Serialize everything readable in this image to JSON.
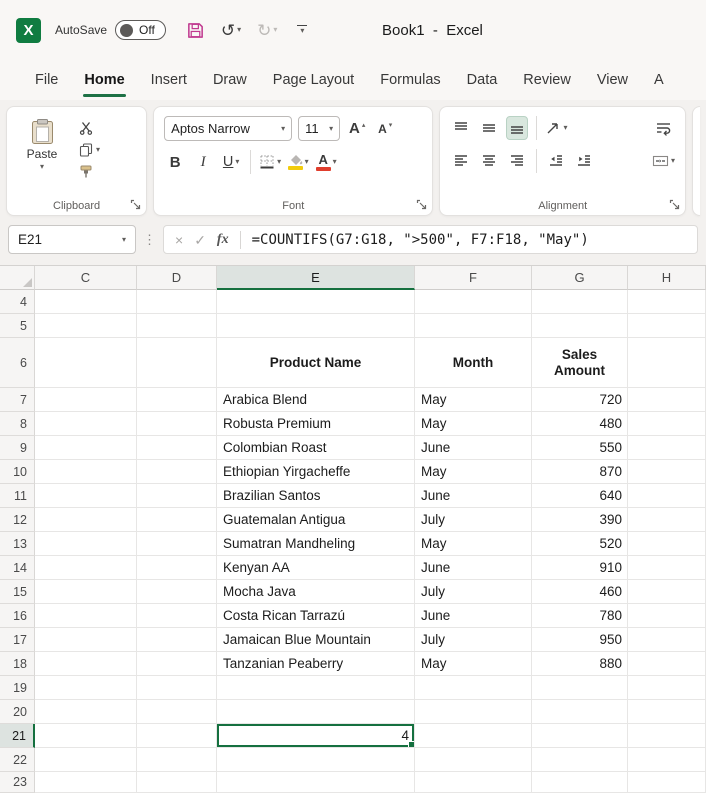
{
  "colors": {
    "excel_green": "#107c41",
    "tab_underline_green": "#1e7145",
    "selection_green": "#15703f",
    "save_icon_magenta": "#c0398f",
    "fill_color_yellow": "#f2cc0c",
    "font_color_red": "#e03e2d"
  },
  "titlebar": {
    "logo_letter": "X",
    "autosave_label": "AutoSave",
    "autosave_state": "Off",
    "title": "Book1  -  Excel",
    "icons": [
      "excel-logo-icon",
      "save-icon",
      "undo-icon",
      "redo-icon",
      "customize-toolbar-chevron-icon"
    ]
  },
  "menu": {
    "tabs": [
      {
        "label": "File",
        "active": false
      },
      {
        "label": "Home",
        "active": true
      },
      {
        "label": "Insert",
        "active": false
      },
      {
        "label": "Draw",
        "active": false
      },
      {
        "label": "Page Layout",
        "active": false
      },
      {
        "label": "Formulas",
        "active": false
      },
      {
        "label": "Data",
        "active": false
      },
      {
        "label": "Review",
        "active": false
      },
      {
        "label": "View",
        "active": false
      },
      {
        "label": "A",
        "active": false
      }
    ]
  },
  "ribbon": {
    "clipboard": {
      "label": "Clipboard",
      "paste_label": "Paste",
      "icons": [
        "clipboard-paste-icon",
        "scissors-cut-icon",
        "copy-icon",
        "format-painter-icon",
        "dialog-launcher-icon"
      ]
    },
    "font": {
      "label": "Font",
      "font_name": "Aptos Narrow",
      "font_size": "11",
      "grow_font_label": "A",
      "shrink_font_label": "A",
      "bold_label": "B",
      "italic_label": "I",
      "underline_label": "U",
      "font_color_label": "A",
      "icons": [
        "borders-icon",
        "fill-color-icon",
        "font-color-icon",
        "dialog-launcher-icon"
      ]
    },
    "alignment": {
      "label": "Alignment",
      "icons": [
        "align-top-icon",
        "align-middle-icon",
        "align-bottom-icon",
        "orientation-icon",
        "wrap-text-icon",
        "align-left-icon",
        "align-center-icon",
        "align-right-icon",
        "decrease-indent-icon",
        "increase-indent-icon",
        "merge-center-icon",
        "dialog-launcher-icon"
      ]
    }
  },
  "formula_bar": {
    "name_box": "E21",
    "cancel_glyph": "×",
    "enter_glyph": "✓",
    "fx_label": "fx",
    "formula": "=COUNTIFS(G7:G18, \">500\", F7:F18, \"May\")"
  },
  "grid": {
    "columns": [
      "C",
      "D",
      "E",
      "F",
      "G",
      "H"
    ],
    "first_row": 4,
    "last_row": 23,
    "active_cell": {
      "ref": "E21",
      "col": "E",
      "row": 21,
      "value": 4
    }
  },
  "sheet": {
    "table_header_row": 6,
    "headers": {
      "product": "Product Name",
      "month": "Month",
      "sales": "Sales Amount"
    },
    "data_rows": [
      {
        "row": 7,
        "product": "Arabica Blend",
        "month": "May",
        "amount": 720
      },
      {
        "row": 8,
        "product": "Robusta Premium",
        "month": "May",
        "amount": 480
      },
      {
        "row": 9,
        "product": "Colombian Roast",
        "month": "June",
        "amount": 550
      },
      {
        "row": 10,
        "product": "Ethiopian Yirgacheffe",
        "month": "May",
        "amount": 870
      },
      {
        "row": 11,
        "product": "Brazilian Santos",
        "month": "June",
        "amount": 640
      },
      {
        "row": 12,
        "product": "Guatemalan Antigua",
        "month": "July",
        "amount": 390
      },
      {
        "row": 13,
        "product": "Sumatran Mandheling",
        "month": "May",
        "amount": 520
      },
      {
        "row": 14,
        "product": "Kenyan AA",
        "month": "June",
        "amount": 910
      },
      {
        "row": 15,
        "product": "Mocha Java",
        "month": "July",
        "amount": 460
      },
      {
        "row": 16,
        "product": "Costa Rican Tarrazú",
        "month": "June",
        "amount": 780
      },
      {
        "row": 17,
        "product": "Jamaican Blue Mountain",
        "month": "July",
        "amount": 950
      },
      {
        "row": 18,
        "product": "Tanzanian Peaberry",
        "month": "May",
        "amount": 880
      }
    ]
  }
}
